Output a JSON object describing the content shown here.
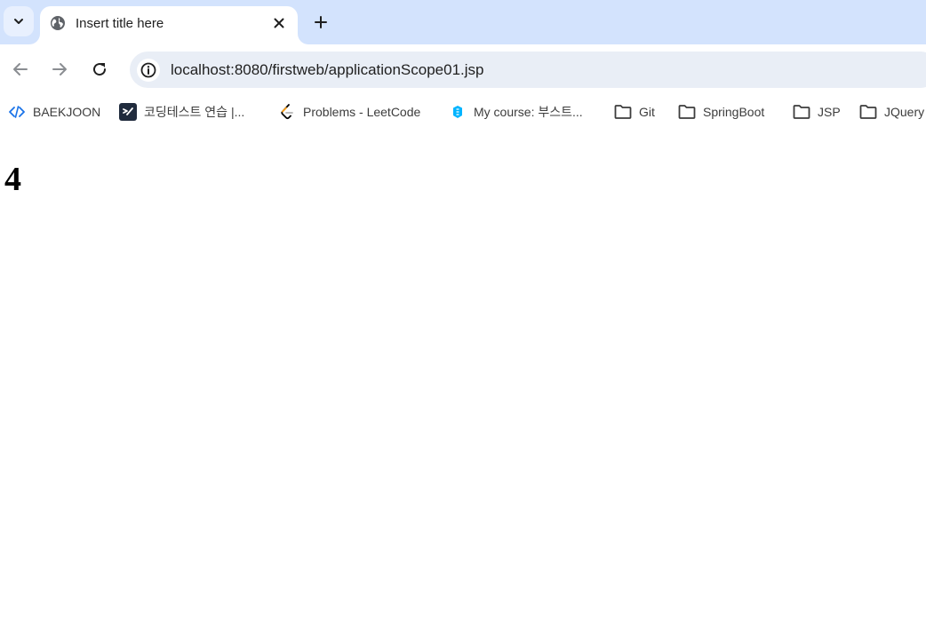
{
  "tab": {
    "title": "Insert title here"
  },
  "address_bar": {
    "url": "localhost:8080/firstweb/applicationScope01.jsp"
  },
  "bookmarks": [
    {
      "label": "BAEKJOON",
      "icon": "code-brackets-icon"
    },
    {
      "label": "코딩테스트 연습 |...",
      "icon": "programmers-icon"
    },
    {
      "label": "Problems - LeetCode",
      "icon": "leetcode-icon"
    },
    {
      "label": "My course: 부스트...",
      "icon": "boostcourse-icon"
    },
    {
      "label": "Git",
      "icon": "folder-icon"
    },
    {
      "label": "SpringBoot",
      "icon": "folder-icon"
    },
    {
      "label": "JSP",
      "icon": "folder-icon"
    },
    {
      "label": "JQuery",
      "icon": "folder-icon"
    }
  ],
  "page": {
    "heading": "4"
  },
  "colors": {
    "tabstrip": "#d3e3fd",
    "omnibox": "#e9eef6",
    "baekjoon_icon": "#1a73e8",
    "programmers_icon": "#202b3d",
    "leetcode_orange": "#ffa116",
    "boostcourse_icon": "#00b4ff"
  }
}
